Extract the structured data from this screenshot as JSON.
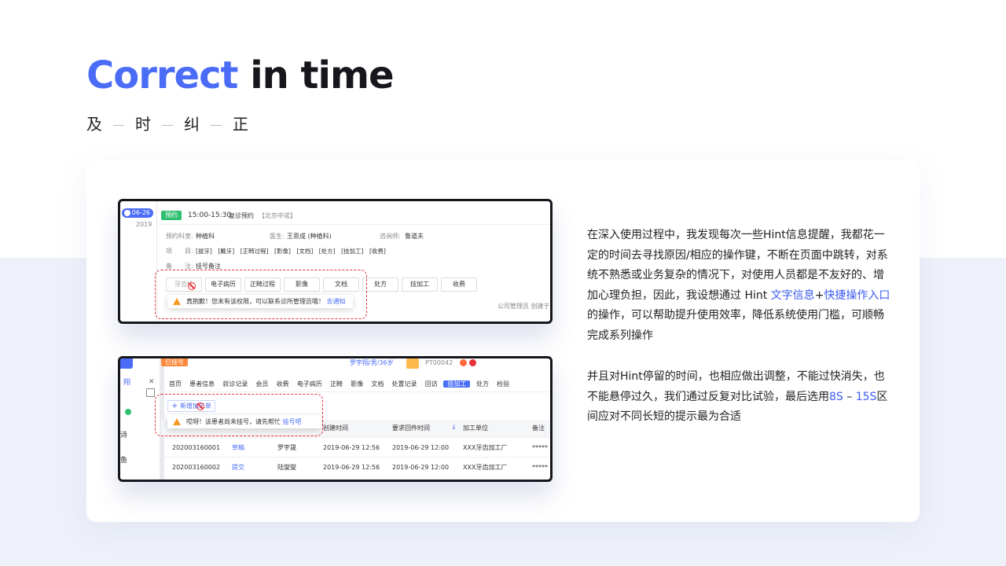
{
  "header": {
    "title_accent": "Correct",
    "title_rest": " in time",
    "subtitle_chars": [
      "及",
      "时",
      "纠",
      "正"
    ]
  },
  "shot1": {
    "date": "06-26",
    "year": "2019",
    "status_tag": "预约",
    "time_range": "15:00-15:30",
    "visit_type": "复诊预约",
    "location": "【北京中诺】",
    "dept_label": "预约科室:",
    "dept_value": "种植科",
    "doctor_label": "医生:",
    "doctor_value": "王思成 (种植科)",
    "consultant_label": "咨询师:",
    "consultant_value": "鲁道夫",
    "items_label": "项　　目:",
    "items_value": "[拔牙]　[戴牙]　[正畸过程]　[影像]　[文档]　[处方]　[技加工]　[收费]",
    "note_label": "备　　注:",
    "note_value": "挂号备注",
    "buttons": [
      "牙齿检",
      "电子病历",
      "正畸过程",
      "影像",
      "文档",
      "处方",
      "技加工",
      "收费"
    ],
    "creator": "公司管理员 创建于",
    "tip_text": "真抱歉！您未有该权限，可以联系诊所管理员哦！",
    "tip_link": "去通知"
  },
  "shot2": {
    "side_items": [
      "翔",
      "诗",
      "鱼"
    ],
    "status_tag": "已挂号",
    "patient": "罗宇翔/男/36岁",
    "patient_id": "PT00042",
    "tabs": [
      "首页",
      "患者信息",
      "就诊记录",
      "会员",
      "收费",
      "电子病历",
      "正畸",
      "影像",
      "文档",
      "处置记录",
      "回访",
      "技加工",
      "处方",
      "检验"
    ],
    "active_tab": "技加工",
    "add_button": "新增加工单",
    "tip_text": "哎呀！该患者尚未挂号，请先帮忙",
    "tip_link": "挂号吧",
    "headers": [
      "创建时间",
      "要求回件时间",
      "加工单位",
      "备注"
    ],
    "rows": [
      {
        "id": "202003160001",
        "status": "草稿",
        "name": "罗宇晟",
        "created": "2019-06-29 12:56",
        "due": "2019-06-29 12:00",
        "vendor": "XXX牙齿加工厂",
        "note": "*****"
      },
      {
        "id": "202003160002",
        "status": "提交",
        "name": "陆燮燮",
        "created": "2019-06-29 12:56",
        "due": "2019-06-29 12:00",
        "vendor": "XXX牙齿加工厂",
        "note": "*****"
      }
    ]
  },
  "description": {
    "p1_part1": "在深入使用过程中，我发现每次一些Hint信息提醒，我都花一定的时间去寻找原因/相应的操作键，不断在页面中跳转，对系统不熟悉或业务复杂的情况下，对使用人员都是不友好的、增加心理负担，因此，我设想通过 Hint ",
    "p1_link1": "文字信息",
    "p1_plus": "+",
    "p1_link2": "快捷操作入口",
    "p1_part2": "的操作，可以帮助提升使用效率，降低系统使用门槛，可顺畅完成系列操作",
    "p2_part1": "并且对Hint停留的时间，也相应做出调整，不能过快消失，也不能悬停过久，我们通过反复对比试验，最后选用",
    "p2_hl1": "8S",
    "p2_dash": " – ",
    "p2_hl2": "15S",
    "p2_part2": "区间应对不同长短的提示最为合适"
  },
  "colors": {
    "accent": "#4a6cf7",
    "warning": "#e8313a",
    "tip_icon": "#f59a23",
    "success": "#2fbf71"
  }
}
